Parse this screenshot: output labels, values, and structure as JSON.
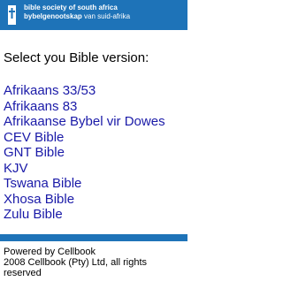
{
  "header": {
    "logo_line1": "bible society of south africa",
    "logo_line2_bold": "bybelgenootskap",
    "logo_line2_rest": " van suid-afrika",
    "logo_icon": "bible-society-logo-icon",
    "background_color": "#1e73b8"
  },
  "prompt": "Select you Bible version:",
  "versions": [
    {
      "label": "Afrikaans 33/53"
    },
    {
      "label": "Afrikaans 83"
    },
    {
      "label": "Afrikaanse Bybel vir Dowes"
    },
    {
      "label": "CEV Bible"
    },
    {
      "label": "GNT Bible"
    },
    {
      "label": "KJV"
    },
    {
      "label": "Tswana Bible"
    },
    {
      "label": "Xhosa Bible"
    },
    {
      "label": "Zulu Bible"
    }
  ],
  "link_color": "#1a1aa8",
  "footer": {
    "powered_by": "Powered by Cellbook",
    "copyright": "2008 Cellbook (Pty) Ltd, all rights reserved"
  }
}
